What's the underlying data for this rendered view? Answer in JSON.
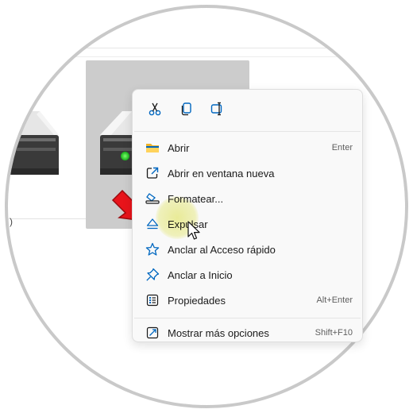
{
  "left_drive_label": ")",
  "toolbar": {
    "cut_icon": "scissors-icon",
    "copy_icon": "copy-icon",
    "rename_icon": "rename-icon"
  },
  "menu": {
    "items": [
      {
        "label": "Abrir",
        "shortcut": "Enter",
        "icon": "folder-icon"
      },
      {
        "label": "Abrir en ventana nueva",
        "shortcut": "",
        "icon": "open-new-window-icon"
      },
      {
        "label": "Formatear...",
        "shortcut": "",
        "icon": "format-icon"
      },
      {
        "label": "Expulsar",
        "shortcut": "",
        "icon": "eject-icon"
      },
      {
        "label": "Anclar al Acceso rápido",
        "shortcut": "",
        "icon": "star-icon"
      },
      {
        "label": "Anclar a Inicio",
        "shortcut": "",
        "icon": "pin-icon"
      },
      {
        "label": "Propiedades",
        "shortcut": "Alt+Enter",
        "icon": "properties-icon"
      },
      {
        "label": "Mostrar más opciones",
        "shortcut": "Shift+F10",
        "icon": "more-options-icon"
      }
    ]
  },
  "colors": {
    "accent": "#0067c0",
    "arrow": "#e8141b",
    "highlight": "#eef096",
    "led": "#17b21a"
  }
}
